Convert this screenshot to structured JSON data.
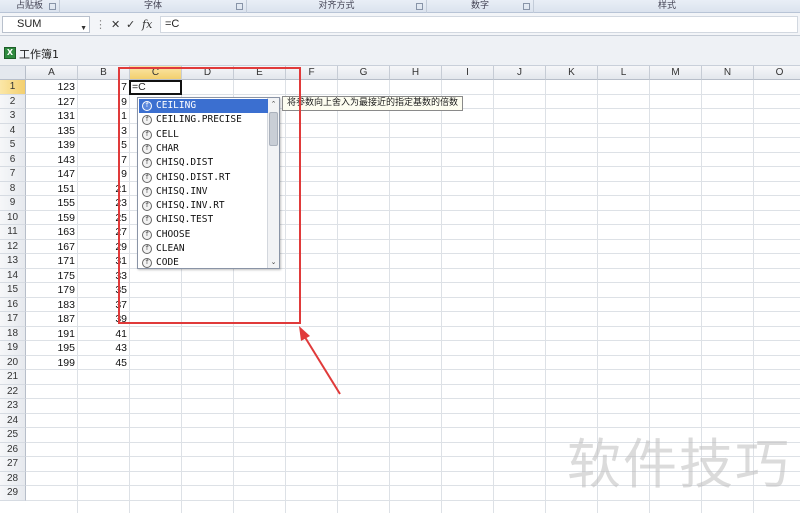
{
  "ribbon": {
    "groups": [
      {
        "label": "剪贴板",
        "display": "占贴板"
      },
      {
        "label": "字体"
      },
      {
        "label": "对齐方式"
      },
      {
        "label": "数字"
      },
      {
        "label": "样式"
      }
    ]
  },
  "formula_bar": {
    "name_box": "SUM",
    "cancel_glyph": "✕",
    "enter_glyph": "✓",
    "fx_glyph": "fx",
    "content": "=C"
  },
  "workbook": {
    "title": "工作簿1"
  },
  "sheet": {
    "columns": [
      "A",
      "B",
      "C",
      "D",
      "E",
      "F",
      "G",
      "H",
      "I",
      "J",
      "K",
      "L",
      "M",
      "N",
      "O"
    ],
    "active_column": "C",
    "rows": [
      "1",
      "2",
      "3",
      "4",
      "5",
      "6",
      "7",
      "8",
      "9",
      "10",
      "11",
      "12",
      "13",
      "14",
      "15",
      "16",
      "17",
      "18",
      "19",
      "20",
      "21",
      "22",
      "23",
      "24",
      "25",
      "26",
      "27",
      "28",
      "29"
    ],
    "active_row": "1",
    "col_a": [
      "123",
      "127",
      "131",
      "135",
      "139",
      "143",
      "147",
      "151",
      "155",
      "159",
      "163",
      "167",
      "171",
      "175",
      "179",
      "183",
      "187",
      "191",
      "195",
      "199"
    ],
    "col_b": [
      "7",
      "9",
      "1",
      "3",
      "5",
      "7",
      "9",
      "21",
      "23",
      "25",
      "27",
      "29",
      "31",
      "33",
      "35",
      "37",
      "39",
      "41",
      "43",
      "45"
    ],
    "active_cell_text": "=C"
  },
  "autocomplete": {
    "items": [
      "CEILING",
      "CEILING.PRECISE",
      "CELL",
      "CHAR",
      "CHISQ.DIST",
      "CHISQ.DIST.RT",
      "CHISQ.INV",
      "CHISQ.INV.RT",
      "CHISQ.TEST",
      "CHOOSE",
      "CLEAN",
      "CODE"
    ],
    "selected_index": 0,
    "tooltip": "将参数向上舍入为最接近的指定基数的倍数"
  },
  "watermark": "软件技巧",
  "colors": {
    "highlight": "#e03a3a",
    "selection": "#3b6fd0"
  }
}
